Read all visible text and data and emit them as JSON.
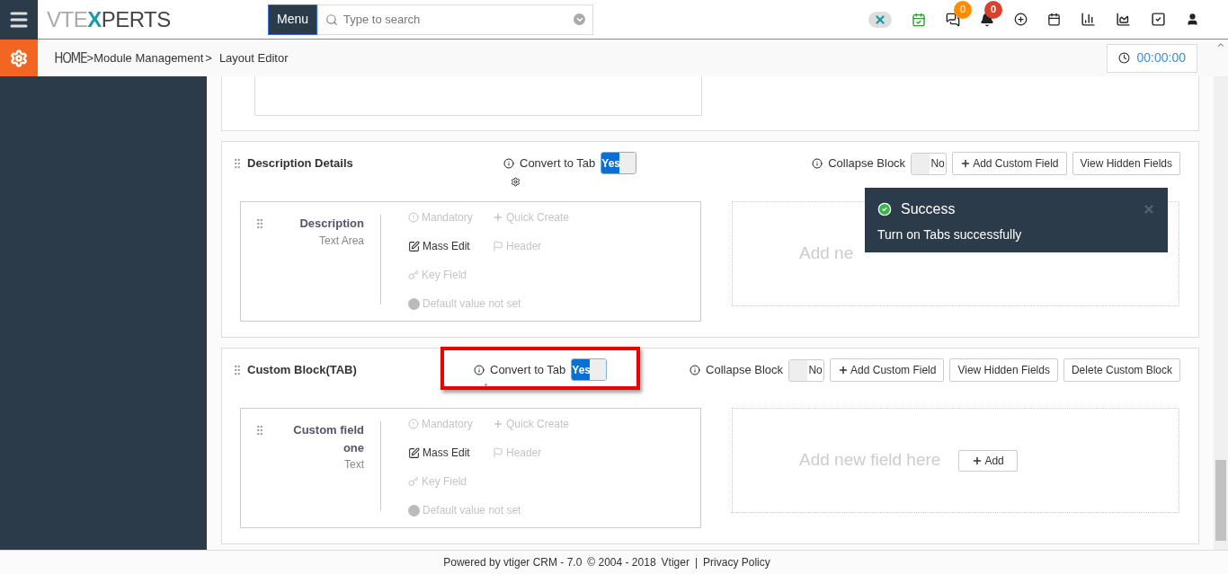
{
  "topbar": {
    "logo": "VTEXPERTS",
    "menu_button": "Menu",
    "search": {
      "placeholder": "Type to search"
    },
    "badges": {
      "chat": "0",
      "notifications": "0"
    }
  },
  "breadcrumb": {
    "home": "HOME",
    "items": [
      ">Module Management",
      ">",
      "Layout Editor"
    ],
    "timer": "00:00:00"
  },
  "blocks": [
    {
      "title": "Description Details",
      "convert_to_tab": {
        "label": "Convert to Tab",
        "on": true,
        "text": "Yes",
        "highlighted": false
      },
      "collapse_block": {
        "label": "Collapse Block",
        "on": false,
        "text": "No"
      },
      "buttons": [
        {
          "label": "Add Custom Field",
          "kind": "add"
        },
        {
          "label": "View Hidden Fields",
          "kind": "plain"
        }
      ],
      "fields": [
        {
          "name": "Description",
          "type": "Text Area",
          "flags": [
            {
              "label": "Mandatory",
              "kind": "mandatory",
              "enabled": false
            },
            {
              "label": "Quick Create",
              "kind": "quick",
              "enabled": false
            },
            {
              "label": "Mass Edit",
              "kind": "mass",
              "enabled": true
            },
            {
              "label": "Header",
              "kind": "header",
              "enabled": false
            },
            {
              "label": "Key Field",
              "kind": "key",
              "enabled": false
            },
            {
              "label": "Default value not set",
              "kind": "default",
              "enabled": false
            }
          ]
        }
      ],
      "drop_zone": {
        "text": "Add ne"
      }
    },
    {
      "title": "Custom Block(TAB)",
      "convert_to_tab": {
        "label": "Convert to Tab",
        "on": true,
        "text": "Yes",
        "highlighted": true
      },
      "collapse_block": {
        "label": "Collapse Block",
        "on": false,
        "text": "No"
      },
      "buttons": [
        {
          "label": "Add Custom Field",
          "kind": "add"
        },
        {
          "label": "View Hidden Fields",
          "kind": "plain"
        },
        {
          "label": "Delete Custom Block",
          "kind": "plain"
        }
      ],
      "fields": [
        {
          "name": "Custom field one",
          "type": "Text",
          "flags": [
            {
              "label": "Mandatory",
              "kind": "mandatory",
              "enabled": false
            },
            {
              "label": "Quick Create",
              "kind": "quick",
              "enabled": false
            },
            {
              "label": "Mass Edit",
              "kind": "mass",
              "enabled": true
            },
            {
              "label": "Header",
              "kind": "header",
              "enabled": false
            },
            {
              "label": "Key Field",
              "kind": "key",
              "enabled": false
            },
            {
              "label": "Default value not set",
              "kind": "default",
              "enabled": false
            }
          ]
        }
      ],
      "drop_zone": {
        "text": "Add new field here",
        "button": "Add"
      }
    }
  ],
  "toast": {
    "title": "Success",
    "message": "Turn on Tabs successfully"
  },
  "footer": {
    "powered": "Powered by vtiger CRM - 7.0",
    "copyright": "© 2004 - 2018",
    "vendor": "Vtiger",
    "separator": "|",
    "privacy": "Privacy Policy"
  }
}
